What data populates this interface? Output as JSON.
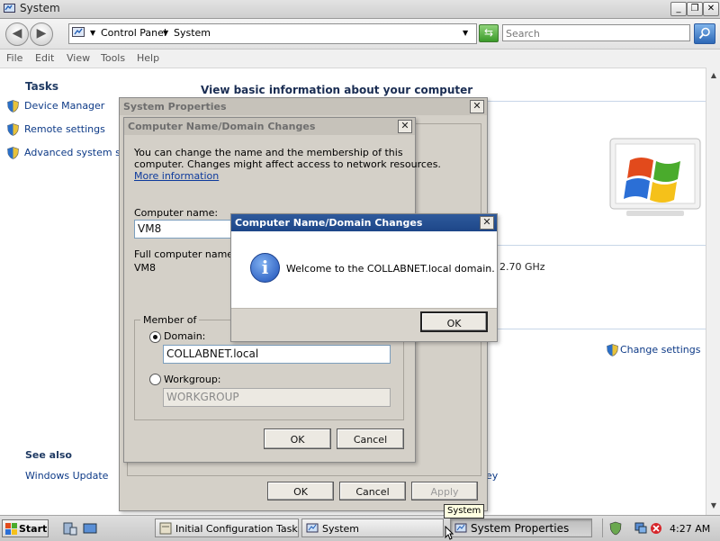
{
  "window": {
    "title": "System"
  },
  "address": {
    "crumbs": [
      "Control Panel",
      "System"
    ],
    "search_placeholder": "Search"
  },
  "menu": [
    "File",
    "Edit",
    "View",
    "Tools",
    "Help"
  ],
  "tasks": {
    "title": "Tasks",
    "items": [
      "Device Manager",
      "Remote settings",
      "Advanced system set"
    ]
  },
  "see_also": {
    "title": "See also",
    "items": [
      "Windows Update"
    ]
  },
  "main": {
    "heading": "View basic information about your computer",
    "fragment_computer": "computer",
    "fragment_ghz": "2.70 GHz",
    "fragment_ey": "ey",
    "change_settings": "Change settings"
  },
  "system_properties": {
    "title": "System Properties",
    "buttons": {
      "ok": "OK",
      "cancel": "Cancel",
      "apply": "Apply"
    }
  },
  "domain_changes": {
    "title": "Computer Name/Domain Changes",
    "intro_line1": "You can change the name and the membership of this",
    "intro_line2": "computer. Changes might affect access to network resources.",
    "more_info": "More information",
    "computer_name_label": "Computer name:",
    "computer_name_value": "VM8",
    "full_name_label": "Full computer name:",
    "full_name_value": "VM8",
    "member_of_label": "Member of",
    "domain_label": "Domain:",
    "domain_value": "COLLABNET.local",
    "workgroup_label": "Workgroup:",
    "workgroup_value": "WORKGROUP",
    "ok": "OK",
    "cancel": "Cancel"
  },
  "message": {
    "title": "Computer Name/Domain Changes",
    "text": "Welcome to the COLLABNET.local domain.",
    "ok": "OK",
    "icon": "info-icon"
  },
  "taskbar": {
    "start": "Start",
    "buttons": [
      "Initial Configuration Tasks",
      "System",
      "System Properties"
    ],
    "tooltip": "System",
    "clock": "4:27 AM"
  }
}
